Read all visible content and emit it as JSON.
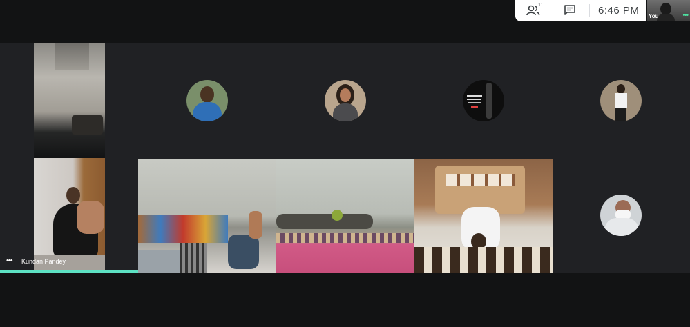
{
  "controls": {
    "people_count": "11",
    "time": "6:46 PM",
    "people_icon": "people-icon",
    "chat_icon": "chat-icon"
  },
  "self_view": {
    "label": "You",
    "more_icon": "more-options-icon"
  },
  "participants": {
    "pinned_name": "Kundan Pandey"
  },
  "colors": {
    "top_bar": "#121314",
    "grid_background": "#202124",
    "speaking_indicator": "#5de2c3",
    "panel_background": "#ffffff"
  }
}
